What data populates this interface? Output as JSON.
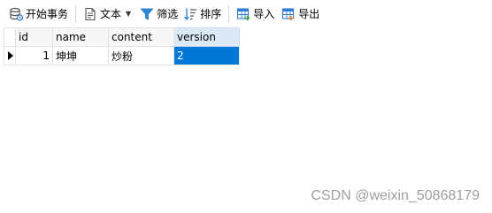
{
  "toolbar": {
    "begin_transaction": "开始事务",
    "text": "文本",
    "filter": "筛选",
    "sort": "排序",
    "import": "导入",
    "export": "导出"
  },
  "grid": {
    "columns": [
      "id",
      "name",
      "content",
      "version"
    ],
    "rows": [
      {
        "id": "1",
        "name": "坤坤",
        "content": "炒粉",
        "version": "2"
      }
    ]
  },
  "watermark": "CSDN @weixin_50868179",
  "colors": {
    "selection": "#0078d7",
    "header_selected": "#dbe8f6"
  }
}
